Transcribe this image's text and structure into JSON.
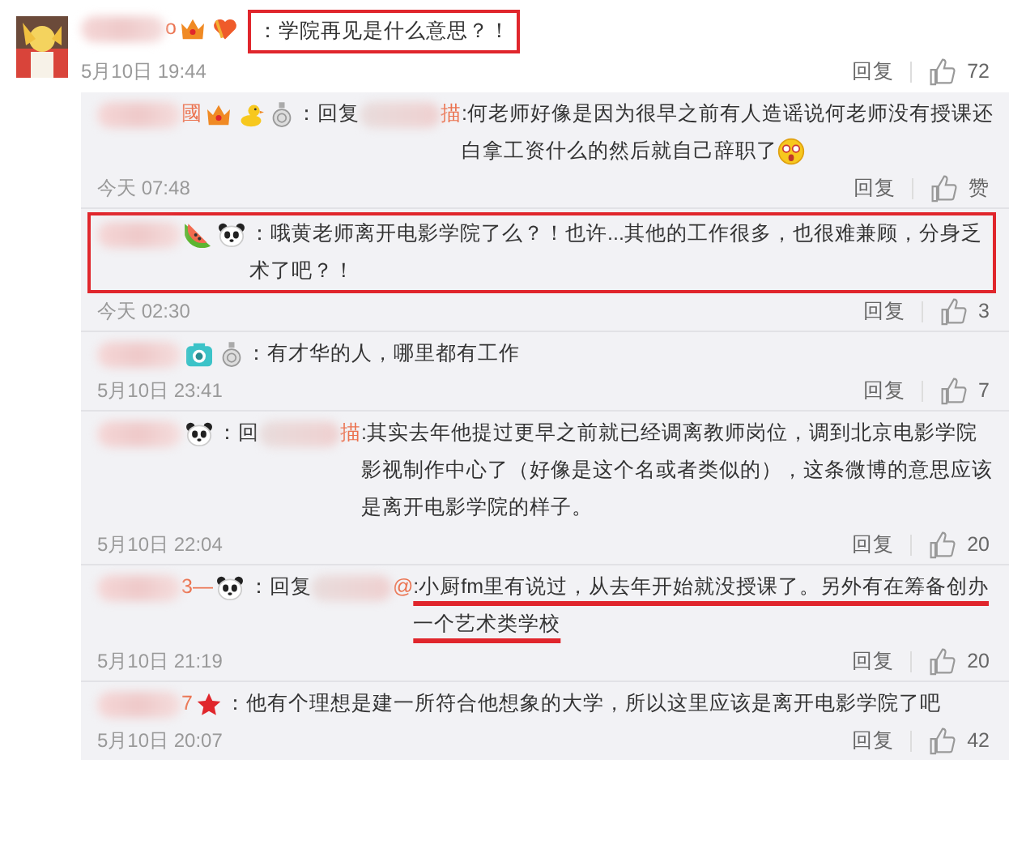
{
  "post": {
    "name_tail": "o",
    "badges": [
      {
        "kind": "crown"
      },
      {
        "kind": "heart"
      }
    ],
    "text": "：学院再见是什么意思？！",
    "emoji": false,
    "time": "5月10日 19:44",
    "reply_label": "回复",
    "likes": "72",
    "framed": true,
    "underlined": false
  },
  "replies": [
    {
      "name_tail": "國",
      "badges": [
        {
          "kind": "crown"
        },
        {
          "kind": "duck"
        },
        {
          "kind": "medal"
        }
      ],
      "prefix": "：回复",
      "mention_tail": "描",
      "text": ":何老师好像是因为很早之前有人造谣说何老师没有授课还白拿工资什么的然后就自己辞职了",
      "emoji": true,
      "time": "今天 07:48",
      "reply_label": "回复",
      "likes": "赞",
      "framed": false,
      "underlined": false
    },
    {
      "badges": [
        {
          "kind": "watermelon"
        },
        {
          "kind": "panda"
        }
      ],
      "text": "：哦黄老师离开电影学院了么？！也许...其他的工作很多，也很难兼顾，分身乏术了吧？！",
      "emoji": false,
      "time": "今天 02:30",
      "reply_label": "回复",
      "likes": "3",
      "framed": true,
      "underlined": false
    },
    {
      "badges": [
        {
          "kind": "camera"
        },
        {
          "kind": "medal"
        }
      ],
      "text": "：有才华的人，哪里都有工作",
      "emoji": false,
      "time": "5月10日 23:41",
      "reply_label": "回复",
      "likes": "7",
      "framed": false,
      "underlined": false
    },
    {
      "badges": [
        {
          "kind": "panda"
        }
      ],
      "prefix": "：回",
      "mention_tail": "描",
      "text": ":其实去年他提过更早之前就已经调离教师岗位，调到北京电影学院影视制作中心了（好像是这个名或者类似的），这条微博的意思应该是离开电影学院的样子。",
      "emoji": false,
      "time": "5月10日 22:04",
      "reply_label": "回复",
      "likes": "20",
      "framed": false,
      "underlined": false
    },
    {
      "name_tail": "3—",
      "badges": [
        {
          "kind": "panda"
        }
      ],
      "prefix": "：回复",
      "mention_tail": "@",
      "text": ":小厨fm里有说过，从去年开始就没授课了。另外有在筹备创办一个艺术类学校",
      "emoji": false,
      "time": "5月10日 21:19",
      "reply_label": "回复",
      "likes": "20",
      "framed": false,
      "underlined": true
    },
    {
      "name_tail": "7",
      "badges": [
        {
          "kind": "star"
        }
      ],
      "text": "：他有个理想是建一所符合他想象的大学，所以这里应该是离开电影学院了吧",
      "emoji": false,
      "time": "5月10日 20:07",
      "reply_label": "回复",
      "likes": "42",
      "framed": false,
      "underlined": false
    }
  ]
}
